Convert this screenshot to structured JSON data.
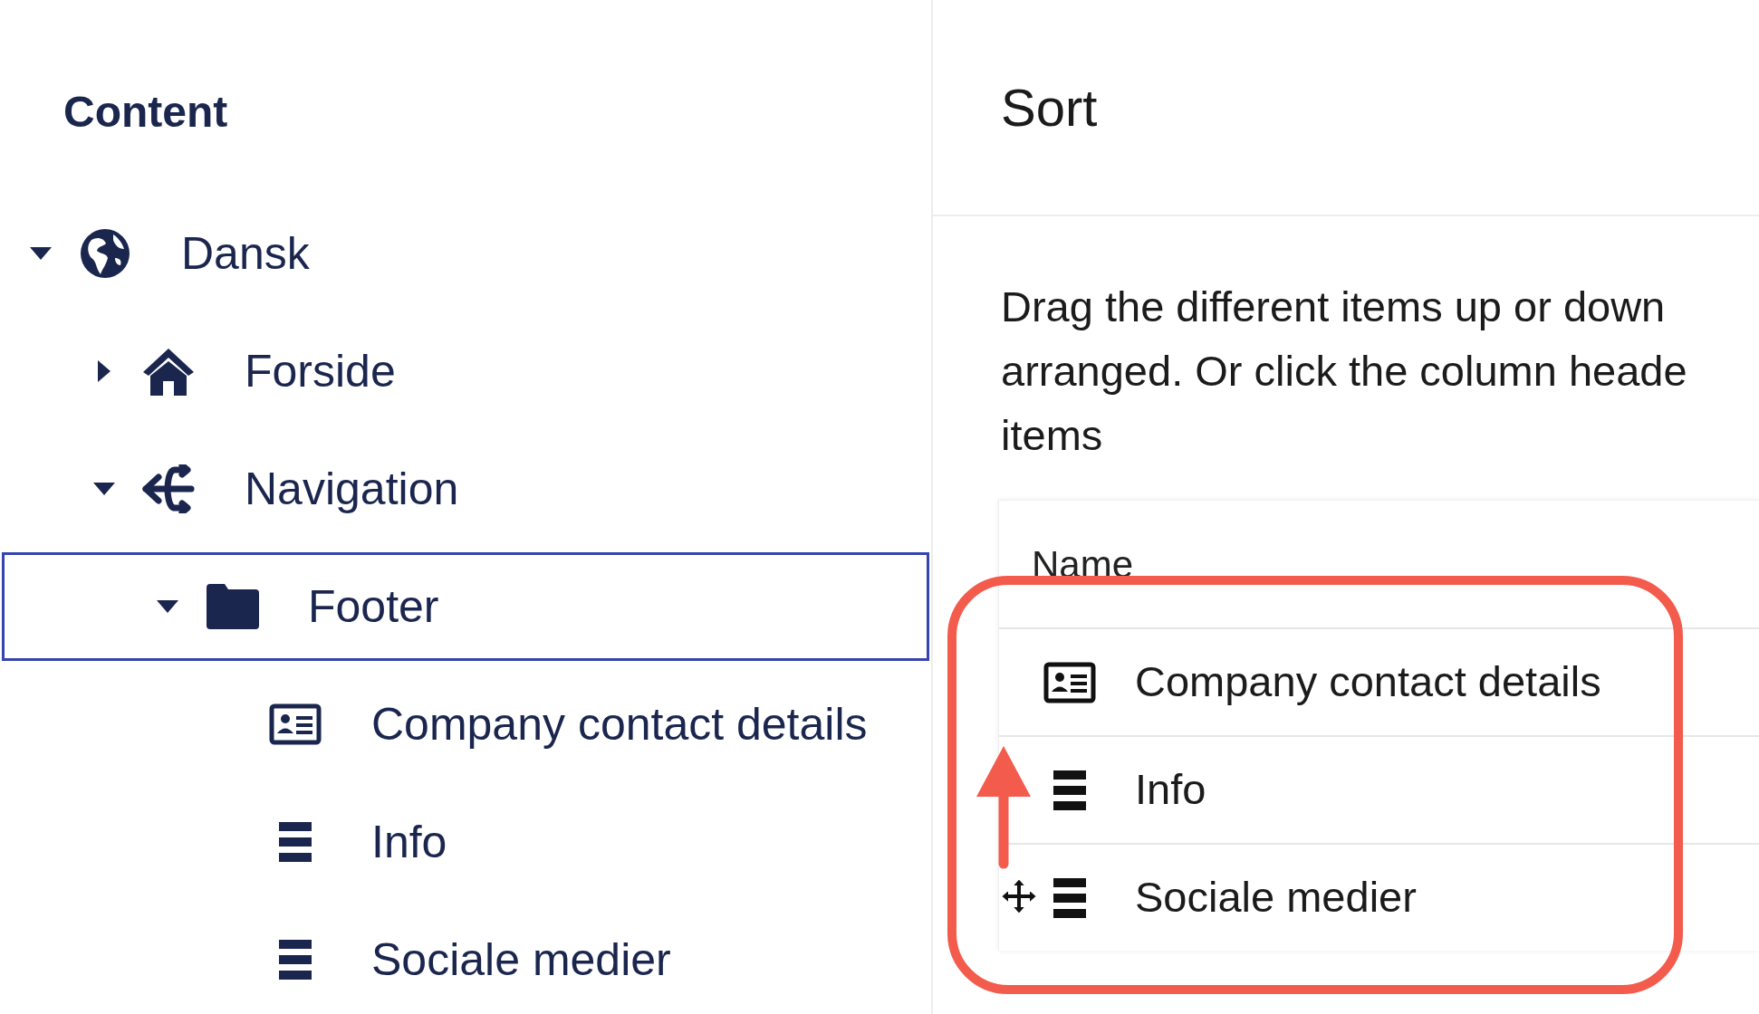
{
  "sidebar": {
    "title": "Content",
    "tree": [
      {
        "label": "Dansk",
        "kind": "globe",
        "expanded": true,
        "selected": false,
        "children": [
          {
            "label": "Forside",
            "kind": "home",
            "expanded": false,
            "selected": false
          },
          {
            "label": "Navigation",
            "kind": "branch",
            "expanded": true,
            "selected": false,
            "children": [
              {
                "label": "Footer",
                "kind": "folder",
                "expanded": true,
                "selected": true,
                "children": [
                  {
                    "label": "Company contact details",
                    "kind": "card",
                    "selected": false
                  },
                  {
                    "label": "Info",
                    "kind": "list",
                    "selected": false
                  },
                  {
                    "label": "Sociale medier",
                    "kind": "list",
                    "selected": false
                  }
                ]
              }
            ]
          }
        ]
      }
    ]
  },
  "sort_panel": {
    "title": "Sort",
    "description_lines": [
      "Drag the different items up or down",
      "arranged. Or click the column heade",
      "items"
    ],
    "table": {
      "columns": [
        "Name"
      ],
      "rows": [
        {
          "label": "Company contact details",
          "kind": "card"
        },
        {
          "label": "Info",
          "kind": "list"
        },
        {
          "label": "Sociale medier",
          "kind": "list"
        }
      ]
    }
  }
}
